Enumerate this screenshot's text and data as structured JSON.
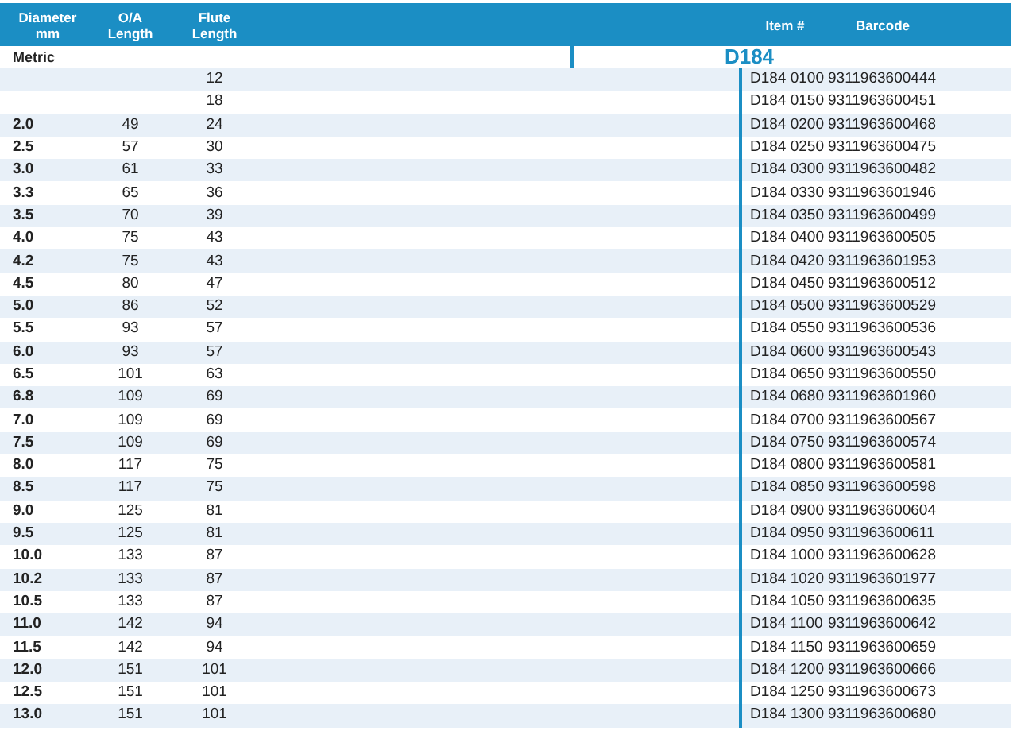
{
  "table": {
    "columns": [
      {
        "lines": [
          "Diameter",
          "mm"
        ]
      },
      {
        "lines": [
          "O/A",
          "Length"
        ]
      },
      {
        "lines": [
          "Flute",
          "Length"
        ]
      },
      {
        "lines": [
          "Item #"
        ]
      },
      {
        "lines": [
          "Barcode"
        ]
      }
    ],
    "section": {
      "label": "Metric",
      "code": "D184"
    },
    "rows": [
      {
        "flute_length": "12",
        "item": "D184 0100",
        "barcode": "9311963600444"
      },
      {
        "flute_length": "18",
        "item": "D184 0150",
        "barcode": "9311963600451"
      },
      {
        "diameter": "2.0",
        "oa_length": "49",
        "flute_length": "24",
        "item": "D184 0200",
        "barcode": "9311963600468"
      },
      {
        "diameter": "2.5",
        "oa_length": "57",
        "flute_length": "30",
        "item": "D184 0250",
        "barcode": "9311963600475"
      },
      {
        "diameter": "3.0",
        "oa_length": "61",
        "flute_length": "33",
        "item": "D184 0300",
        "barcode": "9311963600482"
      },
      {
        "diameter": "3.3",
        "oa_length": "65",
        "flute_length": "36",
        "item": "D184 0330",
        "barcode": "9311963601946"
      },
      {
        "diameter": "3.5",
        "oa_length": "70",
        "flute_length": "39",
        "item": "D184 0350",
        "barcode": "9311963600499"
      },
      {
        "diameter": "4.0",
        "oa_length": "75",
        "flute_length": "43",
        "item": "D184 0400",
        "barcode": "9311963600505"
      },
      {
        "diameter": "4.2",
        "oa_length": "75",
        "flute_length": "43",
        "item": "D184 0420",
        "barcode": "9311963601953"
      },
      {
        "diameter": "4.5",
        "oa_length": "80",
        "flute_length": "47",
        "item": "D184 0450",
        "barcode": "9311963600512"
      },
      {
        "diameter": "5.0",
        "oa_length": "86",
        "flute_length": "52",
        "item": "D184 0500",
        "barcode": "9311963600529"
      },
      {
        "diameter": "5.5",
        "oa_length": "93",
        "flute_length": "57",
        "item": "D184 0550",
        "barcode": "9311963600536"
      },
      {
        "diameter": "6.0",
        "oa_length": "93",
        "flute_length": "57",
        "item": "D184 0600",
        "barcode": "9311963600543"
      },
      {
        "diameter": "6.5",
        "oa_length": "101",
        "flute_length": "63",
        "item": "D184 0650",
        "barcode": "9311963600550"
      },
      {
        "diameter": "6.8",
        "oa_length": "109",
        "flute_length": "69",
        "item": "D184 0680",
        "barcode": "9311963601960"
      },
      {
        "diameter": "7.0",
        "oa_length": "109",
        "flute_length": "69",
        "item": "D184 0700",
        "barcode": "9311963600567"
      },
      {
        "diameter": "7.5",
        "oa_length": "109",
        "flute_length": "69",
        "item": "D184 0750",
        "barcode": "9311963600574"
      },
      {
        "diameter": "8.0",
        "oa_length": "117",
        "flute_length": "75",
        "item": "D184 0800",
        "barcode": "9311963600581"
      },
      {
        "diameter": "8.5",
        "oa_length": "117",
        "flute_length": "75",
        "item": "D184 0850",
        "barcode": "9311963600598"
      },
      {
        "diameter": "9.0",
        "oa_length": "125",
        "flute_length": "81",
        "item": "D184 0900",
        "barcode": "9311963600604"
      },
      {
        "diameter": "9.5",
        "oa_length": "125",
        "flute_length": "81",
        "item": "D184 0950",
        "barcode": "9311963600611"
      },
      {
        "diameter": "10.0",
        "oa_length": "133",
        "flute_length": "87",
        "item": "D184 1000",
        "barcode": "9311963600628"
      },
      {
        "diameter": "10.2",
        "oa_length": "133",
        "flute_length": "87",
        "item": "D184 1020",
        "barcode": "9311963601977"
      },
      {
        "diameter": "10.5",
        "oa_length": "133",
        "flute_length": "87",
        "item": "D184 1050",
        "barcode": "9311963600635"
      },
      {
        "diameter": "11.0",
        "oa_length": "142",
        "flute_length": "94",
        "item": "D184 1100",
        "barcode": "9311963600642"
      },
      {
        "diameter": "11.5",
        "oa_length": "142",
        "flute_length": "94",
        "item": "D184 1150",
        "barcode": "9311963600659"
      },
      {
        "diameter": "12.0",
        "oa_length": "151",
        "flute_length": "101",
        "item": "D184 1200",
        "barcode": "9311963600666"
      },
      {
        "diameter": "12.5",
        "oa_length": "151",
        "flute_length": "101",
        "item": "D184 1250",
        "barcode": "9311963600673"
      },
      {
        "diameter": "13.0",
        "oa_length": "151",
        "flute_length": "101",
        "item": "D184 1300",
        "barcode": "9311963600680"
      }
    ]
  }
}
